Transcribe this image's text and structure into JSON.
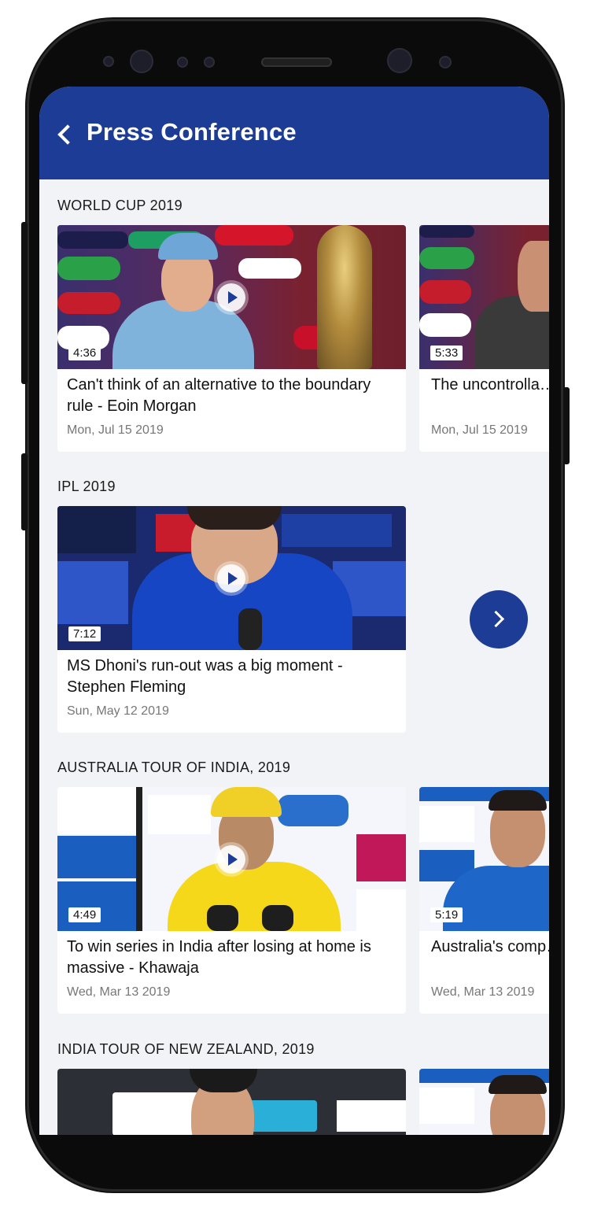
{
  "header": {
    "title": "Press Conference"
  },
  "sections": [
    {
      "title": "WORLD CUP 2019",
      "videos": [
        {
          "duration": "4:36",
          "title": "Can't think of an alternative to the boundary rule - Eoin Morgan",
          "date": "Mon, Jul 15 2019"
        },
        {
          "duration": "5:33",
          "title": "The uncontrolla… swallow - Kane",
          "date": "Mon, Jul 15 2019"
        }
      ]
    },
    {
      "title": "IPL 2019",
      "videos": [
        {
          "duration": "7:12",
          "title": "MS Dhoni's run-out was a big moment - Stephen Fleming",
          "date": "Sun, May 12 2019"
        }
      ]
    },
    {
      "title": "AUSTRALIA TOUR OF INDIA, 2019",
      "videos": [
        {
          "duration": "4:49",
          "title": "To win series in India after losing at home is massive - Khawaja",
          "date": "Wed, Mar 13 2019"
        },
        {
          "duration": "5:19",
          "title": "Australia's comp… them the series",
          "date": "Wed, Mar 13 2019"
        }
      ]
    },
    {
      "title": "INDIA TOUR OF NEW ZEALAND, 2019",
      "videos": []
    }
  ],
  "colors": {
    "primary": "#1c3c95",
    "background": "#f2f3f7"
  },
  "icons": {
    "back": "chevron-left-icon",
    "next": "chevron-right-icon",
    "play": "play-icon"
  }
}
